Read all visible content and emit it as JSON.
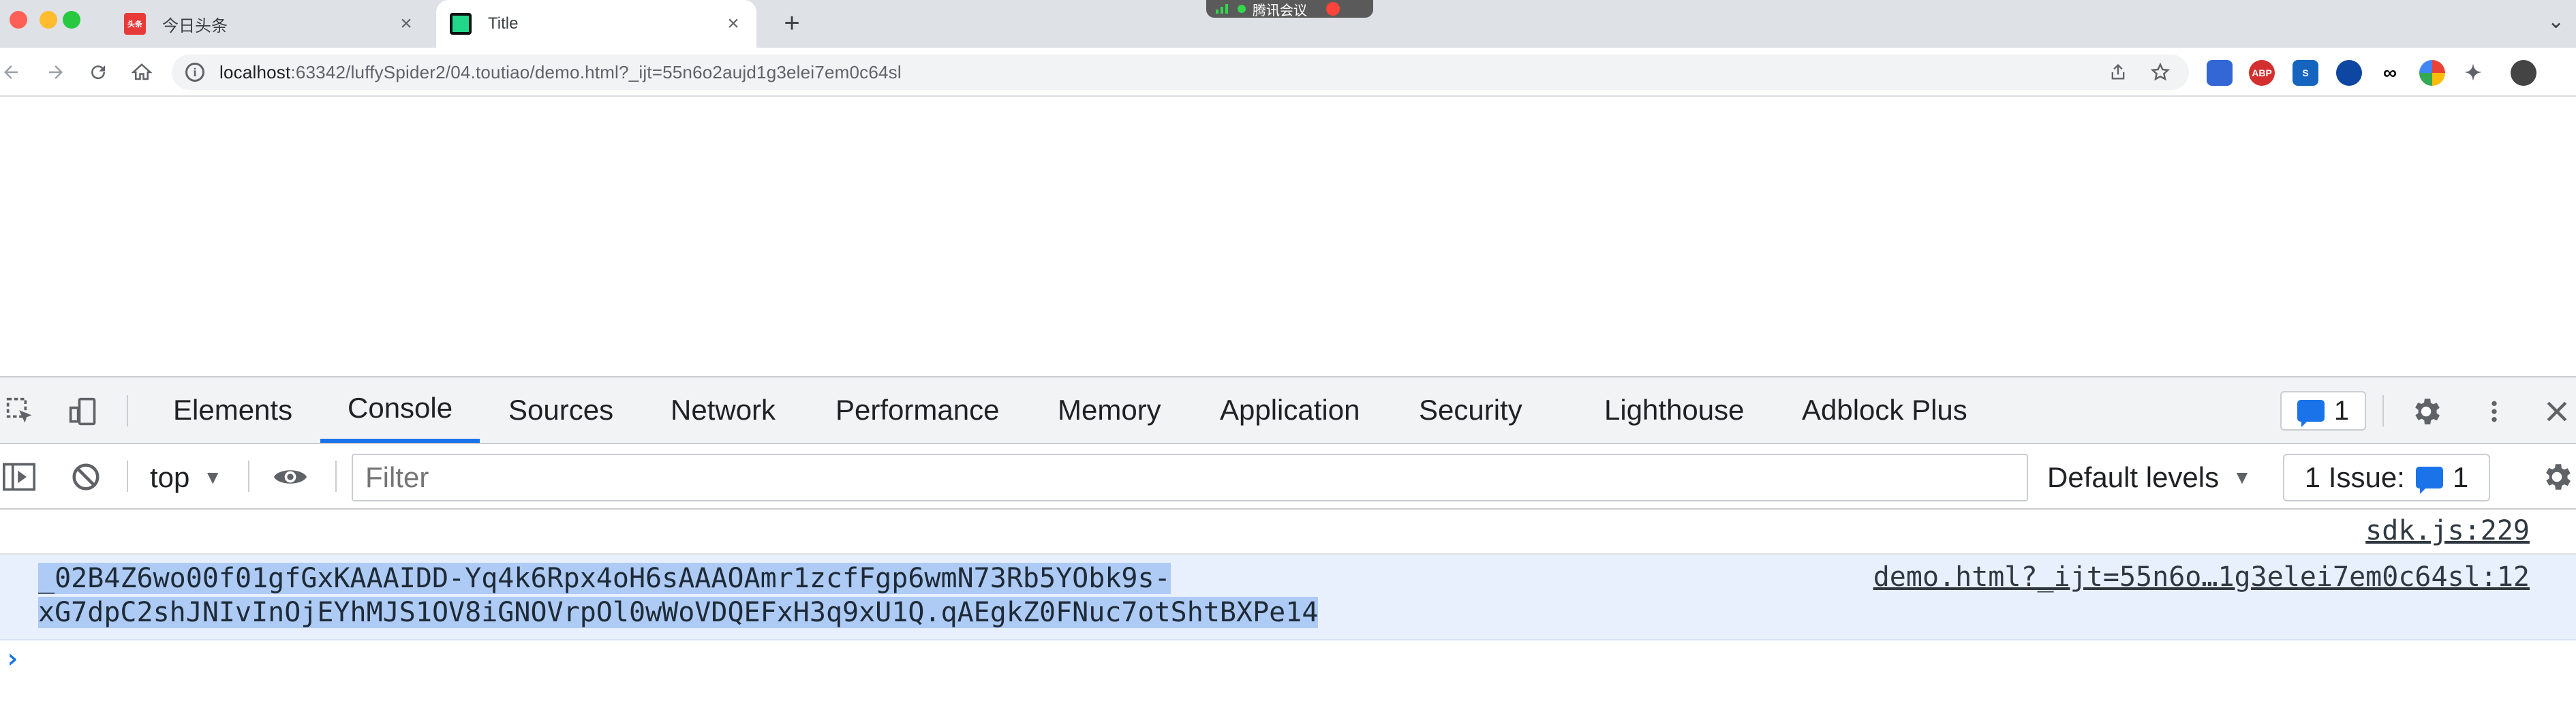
{
  "browser": {
    "tabs": [
      {
        "title": "今日头条",
        "favicon_text": "头条",
        "active": false
      },
      {
        "title": "Title",
        "active": true
      }
    ],
    "new_tab_symbol": "+",
    "overlay_label": "腾讯会议",
    "url": {
      "host": "localhost",
      "rest": ":63342/luffySpider2/04.toutiao/demo.html?_ijt=55n6o2aujd1g3elei7em0c64sl"
    },
    "extensions": [
      {
        "name": "ext-1-icon",
        "color": "#3367d6",
        "label": ""
      },
      {
        "name": "adblock-icon",
        "color": "#d32f2f",
        "label": "ABP"
      },
      {
        "name": "ext-3-icon",
        "color": "#1565c0",
        "label": "S"
      },
      {
        "name": "ext-4-icon",
        "color": "#0d47a1",
        "label": ""
      },
      {
        "name": "ext-5-icon",
        "color": "#000000",
        "label": ""
      },
      {
        "name": "ext-6-icon",
        "color": "#7b1fa2",
        "label": ""
      },
      {
        "name": "puzzle-icon",
        "color": "#5f6368",
        "label": ""
      },
      {
        "name": "avatar",
        "color": "#444444",
        "label": ""
      }
    ]
  },
  "devtools": {
    "tabs": [
      "Elements",
      "Console",
      "Sources",
      "Network",
      "Performance",
      "Memory",
      "Application",
      "Security",
      "Lighthouse",
      "Adblock Plus"
    ],
    "active_tab": "Console",
    "message_count": "1",
    "context": "top",
    "filter_placeholder": "Filter",
    "levels_label": "Default levels",
    "issues_label": "1 Issue:",
    "issues_count": "1",
    "console": {
      "first_source": "sdk.js:229",
      "message_source": "demo.html?_ijt=55n6o…1g3elei7em0c64sl:12",
      "message_line1": "_02B4Z6wo00f01gfGxKAAAIDD-Yq4k6Rpx4oH6sAAAOAmr1zcfFgp6wmN73Rb5YObk9s-",
      "message_line2": "xG7dpC2shJNIvInOjEYhMJS1OV8iGNOVrpOl0wWoVDQEFxH3q9xU1Q.qAEgkZ0FNuc7otShtBXPe14",
      "prompt_symbol": "›"
    }
  },
  "colors": {
    "accent": "#1a73e8",
    "selection": "#aecbf5",
    "message_row": "#e8f0fe"
  }
}
